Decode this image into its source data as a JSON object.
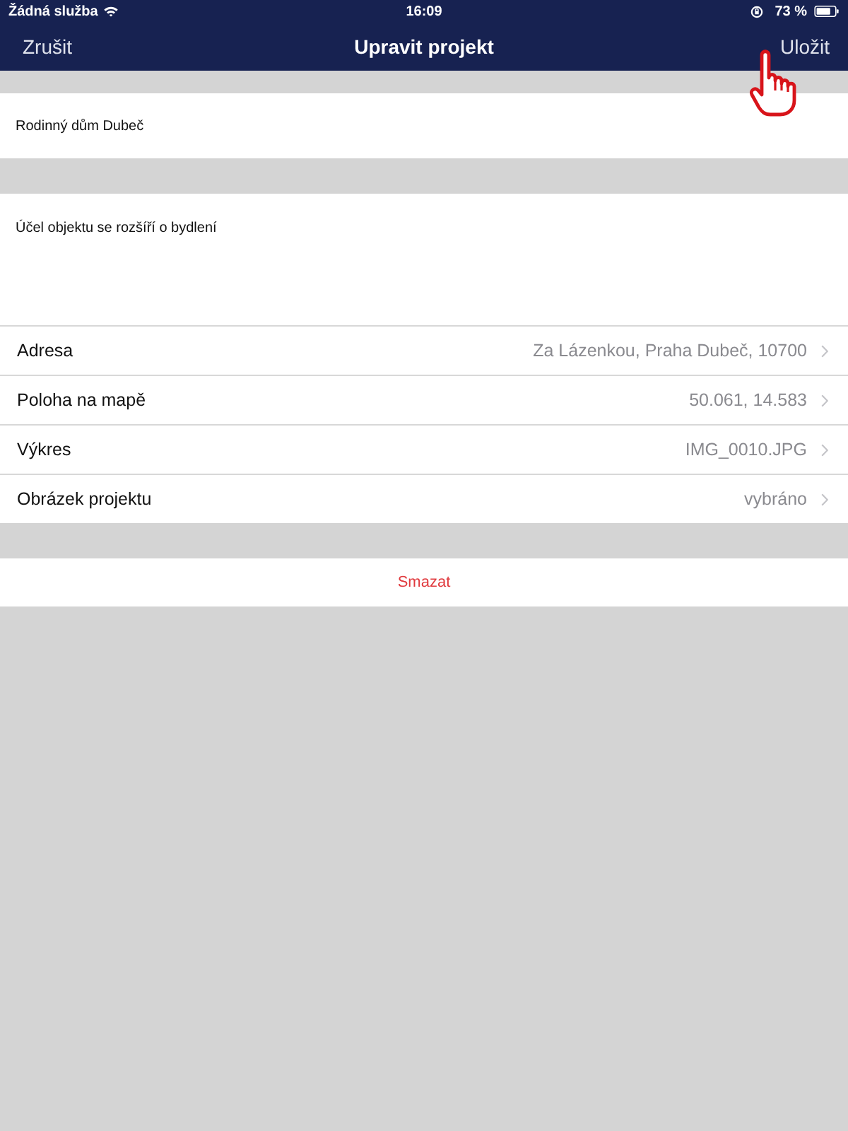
{
  "status_bar": {
    "carrier": "Žádná služba",
    "time": "16:09",
    "battery": "73 %"
  },
  "nav_bar": {
    "left_button": "Zrušit",
    "title": "Upravit projekt",
    "right_button": "Uložit"
  },
  "name_field": {
    "value": "Rodinný dům Dubeč"
  },
  "description_field": {
    "value": "Účel objektu se rozšíří o bydlení"
  },
  "detail_rows": [
    {
      "label": "Adresa",
      "value": "Za Lázenkou, Praha Dubeč, 10700"
    },
    {
      "label": "Poloha na mapě",
      "value": "50.061, 14.583"
    },
    {
      "label": "Výkres",
      "value": "IMG_0010.JPG"
    },
    {
      "label": "Obrázek projektu",
      "value": "vybráno"
    }
  ],
  "delete_button": {
    "label": "Smazat"
  }
}
